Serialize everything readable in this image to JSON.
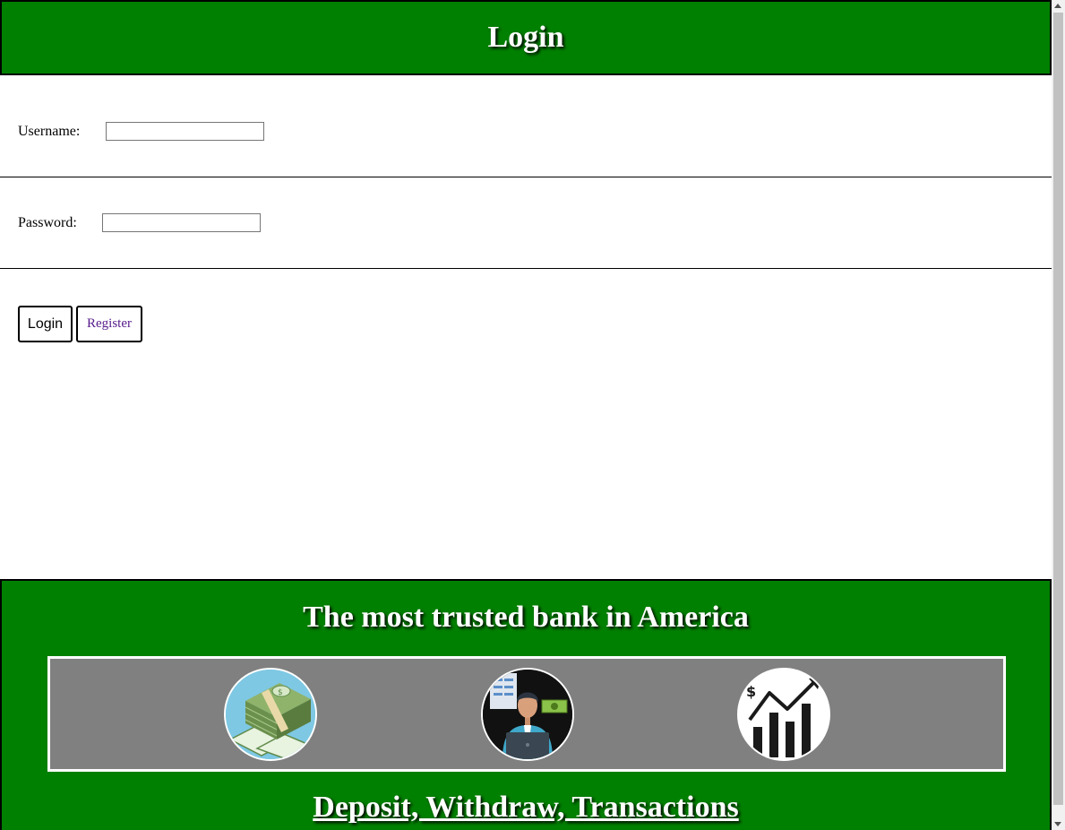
{
  "header": {
    "title": "Login"
  },
  "form": {
    "username_label": "Username:",
    "username_value": "",
    "password_label": "Password:",
    "password_value": "",
    "login_button": "Login",
    "register_button": "Register"
  },
  "footer": {
    "tagline": "The most trusted bank in America",
    "features_link": "Deposit, Withdraw, Transactions",
    "images": [
      "money-stack-icon",
      "banker-with-laptop-icon",
      "growth-chart-icon"
    ]
  },
  "colors": {
    "brand_green": "#008000",
    "panel_gray": "#808080",
    "link_visited": "#551a8b"
  }
}
